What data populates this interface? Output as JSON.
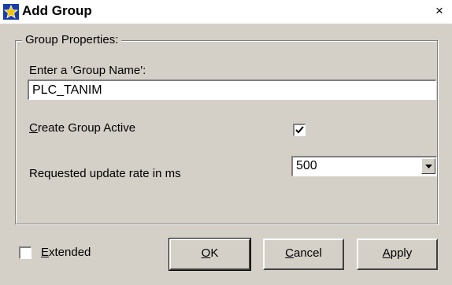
{
  "window": {
    "title": "Add Group",
    "close_glyph": "×",
    "icon": "app-star-icon"
  },
  "group_properties": {
    "legend": "Group Properties:",
    "group_name_label": "Enter a 'Group Name':",
    "group_name_value": "PLC_TANIM",
    "create_active": {
      "label_accel": "C",
      "label_rest": "reate Group Active",
      "checked": true
    },
    "update_rate": {
      "label": "Requested update rate in ms",
      "value": "500"
    }
  },
  "footer": {
    "extended": {
      "label_accel": "E",
      "label_rest": "xtended",
      "checked": false
    },
    "ok": {
      "accel": "O",
      "rest": "K"
    },
    "cancel": {
      "accel": "C",
      "rest": "ancel"
    },
    "apply": {
      "accel": "A",
      "rest": "pply"
    }
  }
}
